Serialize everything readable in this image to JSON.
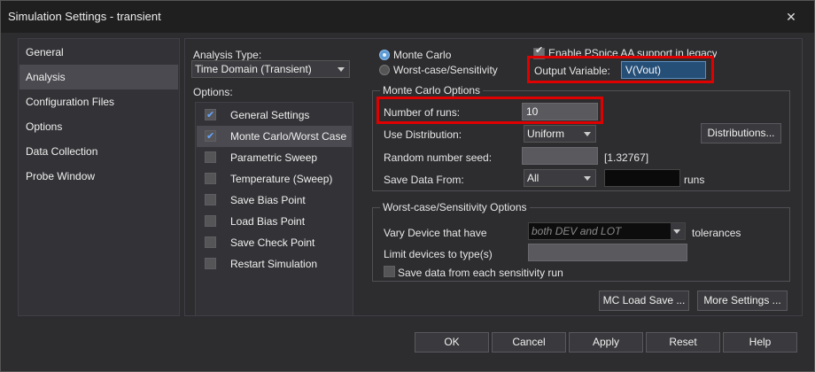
{
  "window": {
    "title": "Simulation Settings - transient"
  },
  "sidebar": {
    "items": [
      {
        "label": "General",
        "active": false
      },
      {
        "label": "Analysis",
        "active": true
      },
      {
        "label": "Configuration Files",
        "active": false
      },
      {
        "label": "Options",
        "active": false
      },
      {
        "label": "Data Collection",
        "active": false
      },
      {
        "label": "Probe Window",
        "active": false
      }
    ]
  },
  "analysis": {
    "type_label": "Analysis Type:",
    "type_value": "Time Domain (Transient)",
    "options_label": "Options:",
    "options": [
      {
        "label": "General Settings",
        "checked": true,
        "active": false
      },
      {
        "label": "Monte Carlo/Worst Case",
        "checked": true,
        "active": true
      },
      {
        "label": "Parametric Sweep",
        "checked": false,
        "active": false
      },
      {
        "label": "Temperature (Sweep)",
        "checked": false,
        "active": false
      },
      {
        "label": "Save Bias Point",
        "checked": false,
        "active": false
      },
      {
        "label": "Load Bias Point",
        "checked": false,
        "active": false
      },
      {
        "label": "Save Check Point",
        "checked": false,
        "active": false
      },
      {
        "label": "Restart Simulation",
        "checked": false,
        "active": false
      }
    ]
  },
  "mode": {
    "monte_carlo_label": "Monte Carlo",
    "worst_case_label": "Worst-case/Sensitivity",
    "enable_pspice_label": "Enable PSpice AA support in legacy",
    "output_variable_label": "Output Variable:",
    "output_variable_value": "V(Vout)"
  },
  "monte_carlo": {
    "group_title": "Monte Carlo Options",
    "runs_label": "Number of runs:",
    "runs_value": "10",
    "distribution_label": "Use Distribution:",
    "distribution_value": "Uniform",
    "distributions_button": "Distributions...",
    "seed_label": "Random number seed:",
    "seed_value": "",
    "seed_range": "[1.32767]",
    "save_data_label": "Save Data From:",
    "save_data_value": "All",
    "save_runs_value": "",
    "runs_suffix": "runs"
  },
  "worst_case": {
    "group_title": "Worst-case/Sensitivity Options",
    "vary_label": "Vary Device that have",
    "vary_value": "both DEV and LOT",
    "tolerances_label": "tolerances",
    "limit_label": "Limit devices to type(s)",
    "limit_value": "",
    "save_each_label": "Save data from each sensitivity run"
  },
  "panel_buttons": {
    "mc_load_save": "MC Load Save ...",
    "more_settings": "More Settings ..."
  },
  "footer": {
    "ok": "OK",
    "cancel": "Cancel",
    "apply": "Apply",
    "reset": "Reset",
    "help": "Help"
  },
  "icons": {
    "close": "close-icon",
    "dropdown": "chevron-down-icon",
    "check": "check-icon"
  },
  "colors": {
    "highlight_box": "#e00000",
    "selected_field": "#264f78",
    "radio_on": "#5b9bd5"
  }
}
